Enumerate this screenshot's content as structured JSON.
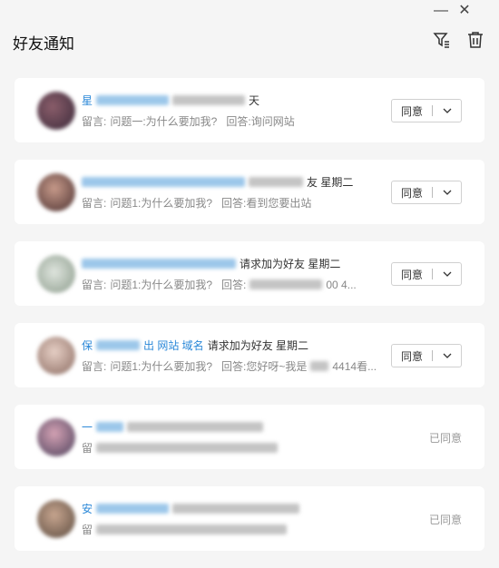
{
  "window": {
    "min_label": "—",
    "close_label": "✕"
  },
  "header": {
    "title": "好友通知"
  },
  "notifications": [
    {
      "name_visible": "星",
      "suffix": "天",
      "message_prefix": "留言:",
      "question": "问题一:为什么要加我?",
      "answer": "回答:询问网站",
      "action": "同意",
      "status": ""
    },
    {
      "name_visible": "",
      "suffix": "友 星期二",
      "message_prefix": "留言:",
      "question": "问题1:为什么要加我?",
      "answer": "回答:看到您要出站",
      "action": "同意",
      "status": ""
    },
    {
      "name_visible": "",
      "suffix": "请求加为好友 星期二",
      "message_prefix": "留言:",
      "question": "问题1:为什么要加我?",
      "answer": "回答:",
      "answer_tail": "00 4...",
      "action": "同意",
      "status": ""
    },
    {
      "name_visible": "保",
      "name_mid": "出 网站 域名",
      "suffix": "请求加为好友 星期二",
      "message_prefix": "留言:",
      "question": "问题1:为什么要加我?",
      "answer": "回答:您好呀~我是",
      "answer_tail": "4414看...",
      "action": "同意",
      "status": ""
    },
    {
      "name_visible": "一",
      "message_prefix": "留",
      "action": "",
      "status": "已同意"
    },
    {
      "name_visible": "安",
      "message_prefix": "留",
      "action": "",
      "status": "已同意"
    }
  ],
  "colors": {
    "accent": "#2b88d8",
    "card_bg": "#ffffff",
    "page_bg": "#f5f5f5"
  },
  "icons": {
    "filter": "filter-icon",
    "trash": "trash-icon",
    "chevron": "chevron-down-icon"
  }
}
